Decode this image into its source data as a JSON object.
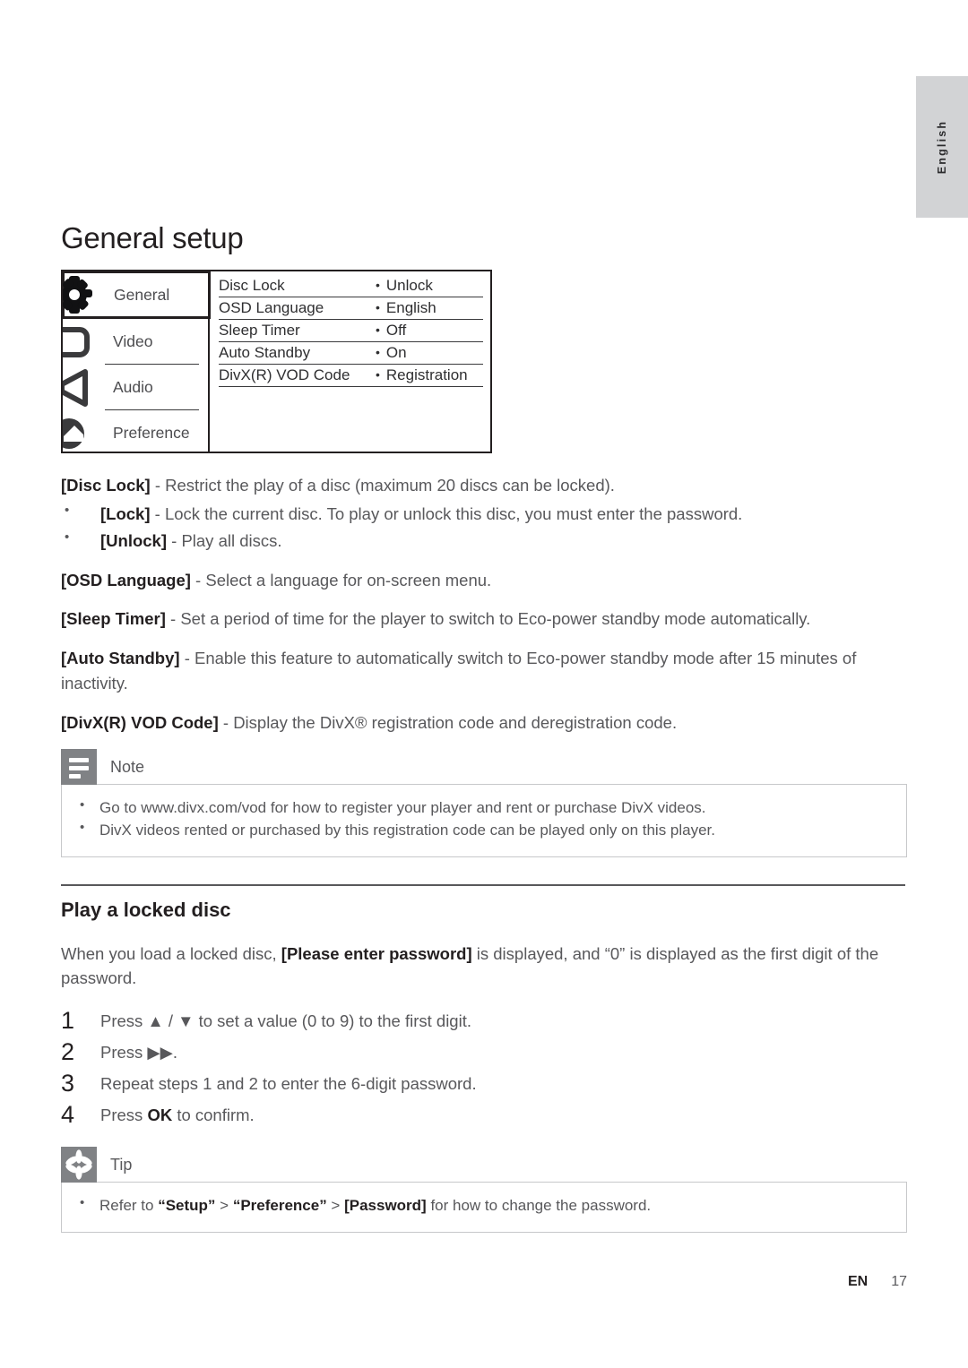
{
  "language_tab": {
    "label": "English"
  },
  "page_title": "General setup",
  "osd_menu": {
    "sidebar": [
      {
        "label": "General",
        "icon": "gear-icon",
        "selected": true
      },
      {
        "label": "Video",
        "icon": "tv-screen-icon",
        "selected": false
      },
      {
        "label": "Audio",
        "icon": "speaker-icon",
        "selected": false
      },
      {
        "label": "Preference",
        "icon": "preference-icon",
        "selected": false
      }
    ],
    "rows": [
      {
        "key": "Disc Lock",
        "value": "Unlock"
      },
      {
        "key": "OSD Language",
        "value": "English"
      },
      {
        "key": "Sleep Timer",
        "value": "Off"
      },
      {
        "key": "Auto Standby",
        "value": "On"
      },
      {
        "key": "DivX(R) VOD Code",
        "value": "Registration"
      }
    ]
  },
  "descriptions": {
    "disc_lock_term": "[Disc Lock]",
    "disc_lock_text": " - Restrict the play of a disc (maximum 20 discs can be locked).",
    "lock_term": "[Lock]",
    "lock_text": " - Lock the current disc. To play or unlock this disc, you must enter the password.",
    "unlock_term": "[Unlock]",
    "unlock_text": " - Play all discs.",
    "osd_language_term": "[OSD Language]",
    "osd_language_text": " - Select a language for on-screen menu.",
    "sleep_timer_term": "[Sleep Timer]",
    "sleep_timer_text": " - Set a period of time for the player to switch to Eco-power standby mode automatically.",
    "auto_standby_term": "[Auto Standby]",
    "auto_standby_text": " - Enable this feature to automatically switch to Eco-power standby mode after 15 minutes of inactivity.",
    "divx_term": "[DivX(R) VOD Code]",
    "divx_text": " - Display the DivX® registration code and deregistration code."
  },
  "note_box": {
    "title": "Note",
    "icon": "note-lines-icon",
    "items": [
      "Go to www.divx.com/vod for how to register your player and rent or purchase DivX videos.",
      "DivX videos rented or purchased by this registration code can be played only on this player."
    ]
  },
  "locked_disc": {
    "heading": "Play a locked disc",
    "intro_part1": "When you load a locked disc, ",
    "intro_bold": "[Please enter password]",
    "intro_part2": " is displayed, and “0” is displayed as the first digit of the password.",
    "steps": [
      {
        "text_before": "Press ▲ / ▼ to set a value (0 to 9) to the first digit.",
        "bold": "",
        "text_after": ""
      },
      {
        "text_before": "Press ▶▶.",
        "bold": "",
        "text_after": ""
      },
      {
        "text_before": "Repeat steps 1 and 2 to enter the 6-digit password.",
        "bold": "",
        "text_after": ""
      },
      {
        "text_before": "Press ",
        "bold": "OK",
        "text_after": " to confirm."
      }
    ]
  },
  "tip_box": {
    "title": "Tip",
    "icon": "asterisk-icon",
    "item_part1": "Refer to ",
    "item_bold1": "“Setup”",
    "item_mid1": " > ",
    "item_bold2": "“Preference”",
    "item_mid2": " > ",
    "item_bold3": "[Password]",
    "item_part2": " for how to change the password."
  },
  "footer": {
    "lang_code": "EN",
    "page_number": "17"
  },
  "colors": {
    "badge_gray": "#808285",
    "tab_gray": "#d2d3d5",
    "text_gray": "#58585b",
    "ink": "#231f20"
  }
}
